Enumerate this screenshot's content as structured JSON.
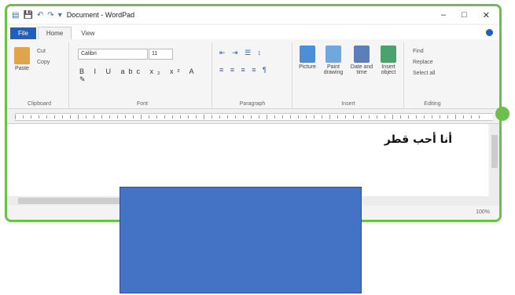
{
  "window": {
    "title": "Document - WordPad",
    "minimize": "–",
    "maximize": "□",
    "close": "✕"
  },
  "quick_access": {
    "app_icon": "wordpad-icon",
    "save": "💾",
    "undo": "↶",
    "redo": "↷",
    "dropdown": "▾"
  },
  "tabs": [
    {
      "label": "File"
    },
    {
      "label": "Home"
    },
    {
      "label": "View"
    }
  ],
  "ribbon": {
    "clipboard": {
      "label": "Clipboard",
      "paste": "Paste",
      "cut": "Cut",
      "copy": "Copy"
    },
    "font": {
      "label": "Font",
      "family": "Calibri",
      "size": "11",
      "format_buttons": "B I U abc x₂ x² A ✎"
    },
    "paragraph": {
      "label": "Paragraph",
      "icons_row1": "⇤ ⇥ ☰ ↕",
      "icons_row2": "≡ ≡ ≡ ≡ ¶"
    },
    "insert": {
      "label": "Insert",
      "picture": "Picture",
      "paint": "Paint drawing",
      "datetime": "Date and time",
      "object": "Insert object"
    },
    "editing": {
      "label": "Editing",
      "find": "Find",
      "replace": "Replace",
      "select_all": "Select all"
    }
  },
  "document": {
    "text": "أنا أحب قطر"
  },
  "colors": {
    "accent_green": "#6cc04a",
    "file_tab": "#1e5fbf",
    "overlay": "#4472c4"
  },
  "status": {
    "zoom": "100%"
  }
}
